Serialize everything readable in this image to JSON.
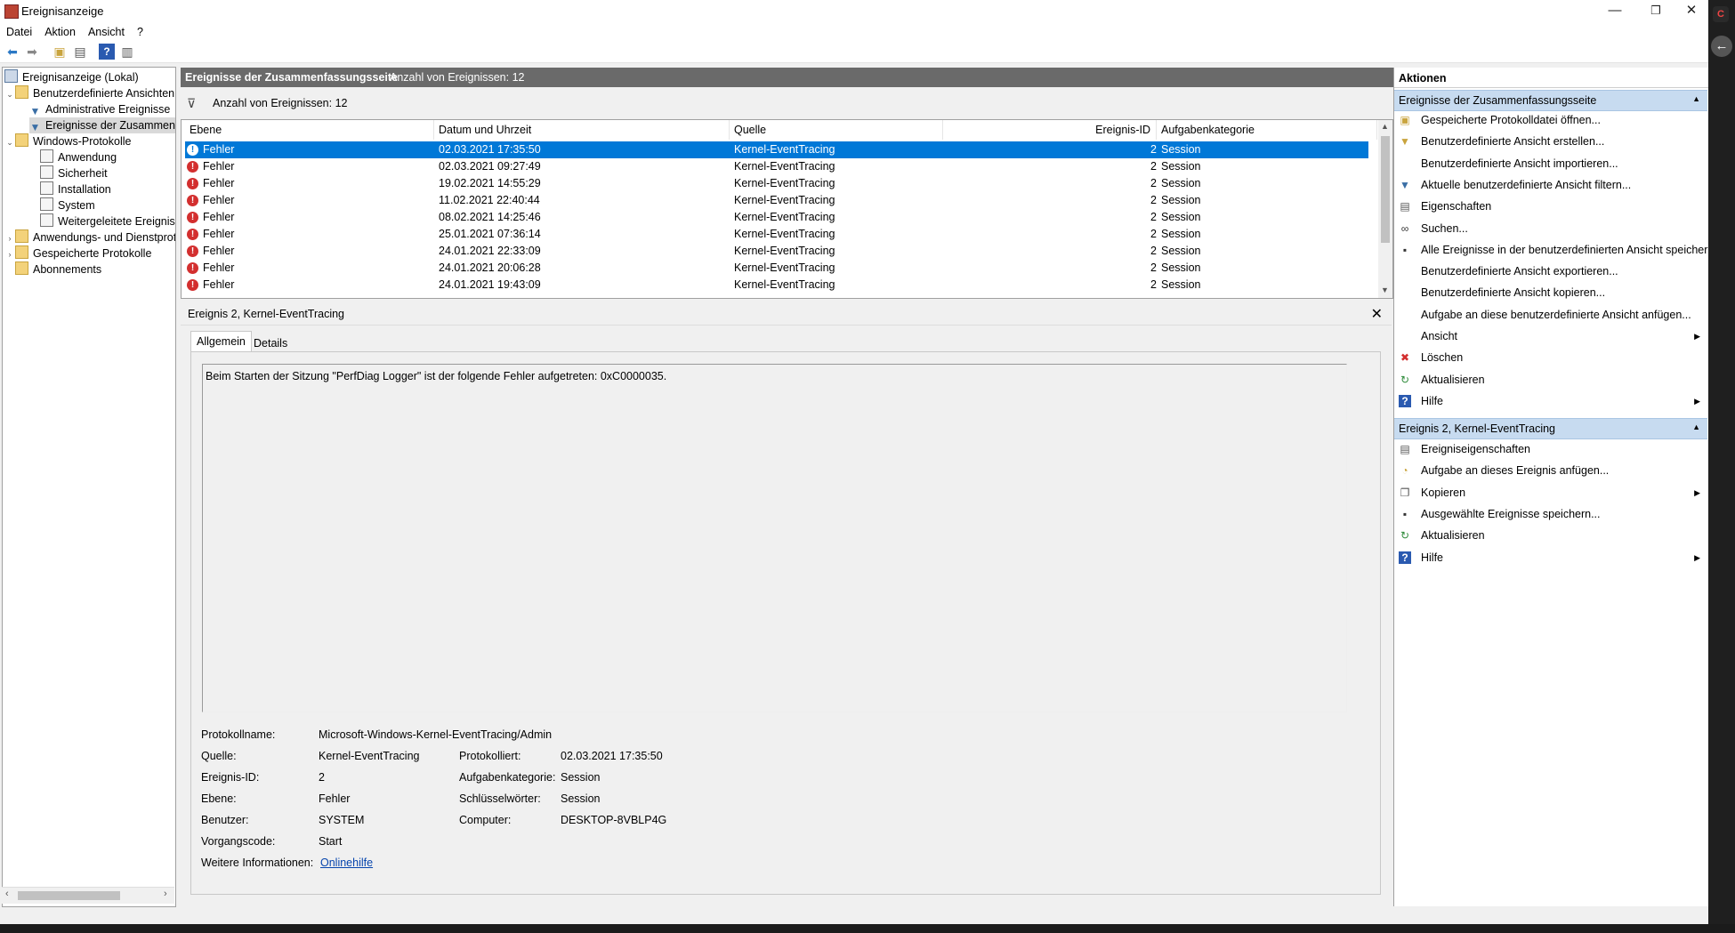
{
  "window": {
    "title": "Ereignisanzeige"
  },
  "menu": [
    "Datei",
    "Aktion",
    "Ansicht",
    "?"
  ],
  "tree": [
    {
      "label": "Ereignisanzeige (Lokal)",
      "level": 0,
      "icon": "computer-icon"
    },
    {
      "label": "Benutzerdefinierte Ansichten",
      "level": 1,
      "icon": "folder-icon",
      "expanded": true
    },
    {
      "label": "Administrative Ereignisse",
      "level": 2,
      "icon": "filter-icon"
    },
    {
      "label": "Ereignisse der Zusammenfassungsseite",
      "level": 2,
      "icon": "filter-icon",
      "selected": true
    },
    {
      "label": "Windows-Protokolle",
      "level": 1,
      "icon": "folder-icon",
      "expanded": true
    },
    {
      "label": "Anwendung",
      "level": 2,
      "icon": "log-icon"
    },
    {
      "label": "Sicherheit",
      "level": 2,
      "icon": "log-icon"
    },
    {
      "label": "Installation",
      "level": 2,
      "icon": "log-icon"
    },
    {
      "label": "System",
      "level": 2,
      "icon": "log-icon"
    },
    {
      "label": "Weitergeleitete Ereignisse",
      "level": 2,
      "icon": "log-icon"
    },
    {
      "label": "Anwendungs- und Dienstprotokolle",
      "level": 1,
      "icon": "folder-icon",
      "expanded": false
    },
    {
      "label": "Gespeicherte Protokolle",
      "level": 1,
      "icon": "folder-icon",
      "expanded": false
    },
    {
      "label": "Abonnements",
      "level": 1,
      "icon": "folder-icon"
    }
  ],
  "center": {
    "header_title": "Ereignisse der Zusammenfassungsseite",
    "header_count": "Anzahl von Ereignissen: 12",
    "filter_count": "Anzahl von Ereignissen: 12",
    "columns": [
      "Ebene",
      "Datum und Uhrzeit",
      "Quelle",
      "Ereignis-ID",
      "Aufgabenkategorie"
    ],
    "rows": [
      {
        "level": "Fehler",
        "datetime": "02.03.2021 17:35:50",
        "source": "Kernel-EventTracing",
        "id": "2",
        "category": "Session",
        "selected": true
      },
      {
        "level": "Fehler",
        "datetime": "02.03.2021 09:27:49",
        "source": "Kernel-EventTracing",
        "id": "2",
        "category": "Session"
      },
      {
        "level": "Fehler",
        "datetime": "19.02.2021 14:55:29",
        "source": "Kernel-EventTracing",
        "id": "2",
        "category": "Session"
      },
      {
        "level": "Fehler",
        "datetime": "11.02.2021 22:40:44",
        "source": "Kernel-EventTracing",
        "id": "2",
        "category": "Session"
      },
      {
        "level": "Fehler",
        "datetime": "08.02.2021 14:25:46",
        "source": "Kernel-EventTracing",
        "id": "2",
        "category": "Session"
      },
      {
        "level": "Fehler",
        "datetime": "25.01.2021 07:36:14",
        "source": "Kernel-EventTracing",
        "id": "2",
        "category": "Session"
      },
      {
        "level": "Fehler",
        "datetime": "24.01.2021 22:33:09",
        "source": "Kernel-EventTracing",
        "id": "2",
        "category": "Session"
      },
      {
        "level": "Fehler",
        "datetime": "24.01.2021 20:06:28",
        "source": "Kernel-EventTracing",
        "id": "2",
        "category": "Session"
      },
      {
        "level": "Fehler",
        "datetime": "24.01.2021 19:43:09",
        "source": "Kernel-EventTracing",
        "id": "2",
        "category": "Session"
      }
    ]
  },
  "details": {
    "title": "Ereignis 2, Kernel-EventTracing",
    "tabs": [
      "Allgemein",
      "Details"
    ],
    "message": "Beim Starten der Sitzung \"PerfDiag Logger\" ist der folgende Fehler aufgetreten: 0xC0000035.",
    "fields": {
      "protokollname_label": "Protokollname:",
      "protokollname": "Microsoft-Windows-Kernel-EventTracing/Admin",
      "quelle_label": "Quelle:",
      "quelle": "Kernel-EventTracing",
      "protokolliert_label": "Protokolliert:",
      "protokolliert": "02.03.2021 17:35:50",
      "id_label": "Ereignis-ID:",
      "id": "2",
      "kategorie_label": "Aufgabenkategorie:",
      "kategorie": "Session",
      "ebene_label": "Ebene:",
      "ebene": "Fehler",
      "schluessel_label": "Schlüsselwörter:",
      "schluessel": "Session",
      "benutzer_label": "Benutzer:",
      "benutzer": "SYSTEM",
      "computer_label": "Computer:",
      "computer": "DESKTOP-8VBLP4G",
      "vorgang_label": "Vorgangscode:",
      "vorgang": "Start",
      "info_label": "Weitere Informationen:",
      "info_link": "Onlinehilfe"
    }
  },
  "actions": {
    "title": "Aktionen",
    "section1": {
      "title": "Ereignisse der Zusammenfassungsseite",
      "items": [
        {
          "label": "Gespeicherte Protokolldatei öffnen...",
          "icon": "open-folder-icon"
        },
        {
          "label": "Benutzerdefinierte Ansicht erstellen...",
          "icon": "create-filter-icon"
        },
        {
          "label": "Benutzerdefinierte Ansicht importieren...",
          "icon": ""
        },
        {
          "label": "Aktuelle benutzerdefinierte Ansicht filtern...",
          "icon": "filter-icon"
        },
        {
          "label": "Eigenschaften",
          "icon": "properties-icon"
        },
        {
          "label": "Suchen...",
          "icon": "binoculars-icon"
        },
        {
          "label": "Alle Ereignisse in der benutzerdefinierten Ansicht speichern unter...",
          "icon": "save-icon"
        },
        {
          "label": "Benutzerdefinierte Ansicht exportieren...",
          "icon": ""
        },
        {
          "label": "Benutzerdefinierte Ansicht kopieren...",
          "icon": ""
        },
        {
          "label": "Aufgabe an diese benutzerdefinierte Ansicht anfügen...",
          "icon": ""
        },
        {
          "label": "Ansicht",
          "icon": "",
          "submenu": true
        },
        {
          "label": "Löschen",
          "icon": "delete-icon"
        },
        {
          "label": "Aktualisieren",
          "icon": "refresh-icon"
        },
        {
          "label": "Hilfe",
          "icon": "help-icon",
          "submenu": true
        }
      ]
    },
    "section2": {
      "title": "Ereignis 2, Kernel-EventTracing",
      "items": [
        {
          "label": "Ereigniseigenschaften",
          "icon": "event-properties-icon"
        },
        {
          "label": "Aufgabe an dieses Ereignis anfügen...",
          "icon": "task-icon"
        },
        {
          "label": "Kopieren",
          "icon": "copy-icon",
          "submenu": true
        },
        {
          "label": "Ausgewählte Ereignisse speichern...",
          "icon": "save-icon"
        },
        {
          "label": "Aktualisieren",
          "icon": "refresh-icon"
        },
        {
          "label": "Hilfe",
          "icon": "help-icon",
          "submenu": true
        }
      ]
    }
  },
  "colors": {
    "selection": "#0078d7",
    "section_header": "#c7dbf0",
    "error": "#d32f2f",
    "center_header": "#6a6a6a"
  }
}
